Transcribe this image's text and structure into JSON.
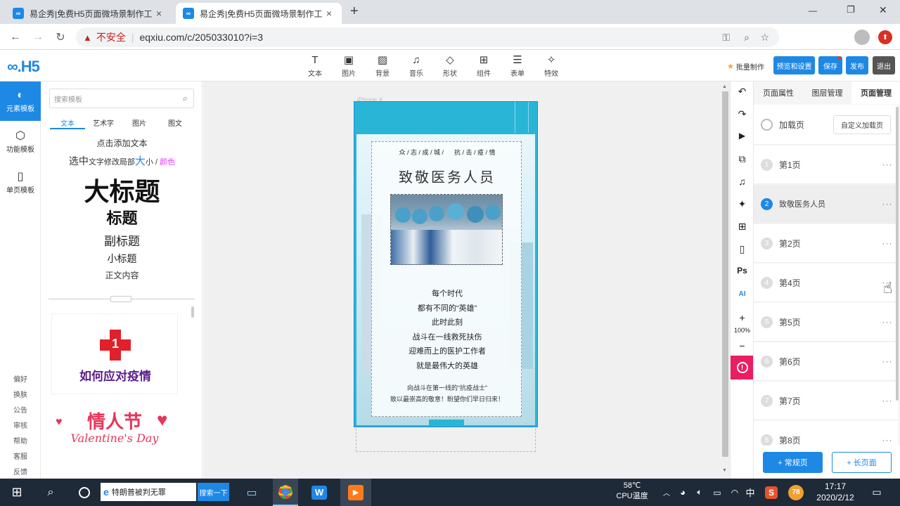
{
  "browser": {
    "tabs": [
      {
        "favicon": "∞",
        "title": "易企秀|免费H5页面微场景制作工",
        "close": "×",
        "active": false
      },
      {
        "favicon": "∞",
        "title": "易企秀|免费H5页面微场景制作工",
        "close": "×",
        "active": true
      }
    ],
    "new_tab": "+",
    "window_controls": {
      "minimize": "—",
      "restore": "❐",
      "close": "✕"
    },
    "address": {
      "warning": "不安全",
      "url": "eqxiu.com/c/205033010?i=3"
    }
  },
  "app": {
    "logo": "∞.H5",
    "tools": [
      {
        "icon": "T",
        "label": "文本"
      },
      {
        "icon": "▣",
        "label": "图片"
      },
      {
        "icon": "▨",
        "label": "背景"
      },
      {
        "icon": "♫",
        "label": "音乐"
      },
      {
        "icon": "◇",
        "label": "形状"
      },
      {
        "icon": "⊞",
        "label": "组件"
      },
      {
        "icon": "☰",
        "label": "表单"
      },
      {
        "icon": "✧",
        "label": "特效"
      }
    ],
    "batch_label": "批量制作",
    "buttons": {
      "preview": "预览和设置",
      "save": "保存",
      "publish": "发布",
      "exit": "退出"
    }
  },
  "rail": {
    "items": [
      {
        "icon": "◐",
        "label": "元素模板",
        "active": true
      },
      {
        "icon": "⬡",
        "label": "功能模板",
        "active": false
      },
      {
        "icon": "▯",
        "label": "单页模板",
        "active": false
      }
    ],
    "links": [
      "偏好",
      "换肤",
      "公告",
      "审核",
      "帮助",
      "客服",
      "反馈"
    ]
  },
  "template_panel": {
    "search_placeholder": "搜索模板",
    "subtabs": [
      "文本",
      "艺术字",
      "图片",
      "图文"
    ],
    "click_add": "点击添加文本",
    "select_hint": {
      "part1": "选中",
      "part2": "文字修改局部",
      "part3": "大",
      "part4": "小 / ",
      "part5": "颜色"
    },
    "big_title": "大标题",
    "title": "标题",
    "subtitle": "副标题",
    "small_title": "小标题",
    "body": "正文内容",
    "card1": "如何应对疫情",
    "card1_badge": "1",
    "card2_title": "情人节",
    "card2_sub": "Valentine's Day"
  },
  "phone": {
    "device_label": "iPhone X",
    "header_line": "众 / 志 / 成 / 城 /      抗 / 击 / 疫 / 情",
    "title": "致敬医务人员",
    "poem": [
      "每个时代",
      "都有不同的“英雄”",
      "此时此刻",
      "战斗在一线救死扶伤",
      "迎难而上的医护工作者",
      "就是最伟大的英雄"
    ],
    "footer": [
      "向战斗在第一线的“抗疫战士”",
      "致以最崇高的敬意！盼望你们早日归来！"
    ]
  },
  "right_strip": {
    "icons": [
      "↶",
      "↷",
      "▶",
      "⧉",
      "♫",
      "✦",
      "⊞",
      "▯",
      "Ps",
      "AI",
      "+",
      "−",
      "!"
    ],
    "zoom": "100%"
  },
  "page_manager": {
    "tabs": [
      "页面属性",
      "图层管理",
      "页面管理"
    ],
    "loading": {
      "label": "加载页",
      "button": "自定义加载页"
    },
    "pages": [
      {
        "num": "1",
        "name": "第1页",
        "active": false
      },
      {
        "num": "2",
        "name": "致敬医务人员",
        "active": true
      },
      {
        "num": "3",
        "name": "第2页",
        "active": false
      },
      {
        "num": "4",
        "name": "第4页",
        "active": false
      },
      {
        "num": "5",
        "name": "第5页",
        "active": false
      },
      {
        "num": "6",
        "name": "第6页",
        "active": false
      },
      {
        "num": "7",
        "name": "第7页",
        "active": false
      },
      {
        "num": "8",
        "name": "第8页",
        "active": false
      }
    ],
    "more": "···",
    "add_normal": "+ 常规页",
    "add_long": "+ 长页面"
  },
  "taskbar": {
    "search_text": "特朗普被判无罪",
    "search_button": "搜索一下",
    "temp": "58℃",
    "temp_label": "CPU温度",
    "ime": "中",
    "badge": "78",
    "time": "17:17",
    "date": "2020/2/12"
  },
  "colors": {
    "primary": "#1e88e5",
    "phone_accent": "#29b6d6",
    "danger": "#e91e63",
    "taskbar": "#1f2a38",
    "tab_active": "#ffffff",
    "tab_bg": "#dee1e6"
  }
}
